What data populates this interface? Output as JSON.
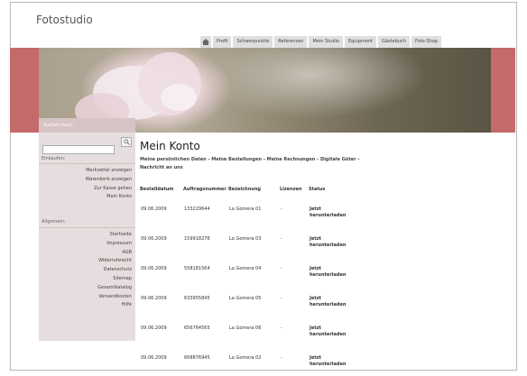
{
  "brand": "Fotostudio",
  "top_nav": [
    "Profil",
    "Schwerpunkte",
    "Referenzen",
    "Mein Studio",
    "Equipment",
    "Gästebuch",
    "Foto-Shop"
  ],
  "sidebar": {
    "search_label": "Suchen nach:",
    "search_value": "",
    "shop_label": "Einkaufen:",
    "shop_links": [
      "Merkzettel anzeigen",
      "Warenkorb anzeigen",
      "Zur Kasse gehen",
      "Mein Konto"
    ],
    "general_label": "Allgemein:",
    "general_links": [
      "Startseite",
      "Impressum",
      "AGB",
      "Widerrufsrecht",
      "Datenschutz",
      "Sitemap",
      "Gesamtkatalog",
      "Versandkosten",
      "Hilfe"
    ]
  },
  "main": {
    "title": "Mein Konto",
    "subnav": [
      "Meine persönlichen Daten",
      "Meine Bestellungen",
      "Meine Rechnungen",
      "Digitale Güter",
      "Nachricht an uns"
    ],
    "table": {
      "headers": [
        "Bestelldatum",
        "Auftragsnummer",
        "Bezeichnung",
        "Lizenzen",
        "Status"
      ],
      "rows": [
        [
          "09.06.2009",
          "133229644",
          "La Gomera 01",
          "-",
          "Jetzt herunterladen"
        ],
        [
          "09.06.2009",
          "159918276",
          "La Gomera 03",
          "-",
          "Jetzt herunterladen"
        ],
        [
          "09.06.2009",
          "558181564",
          "La Gomera 04",
          "-",
          "Jetzt herunterladen"
        ],
        [
          "09.06.2009",
          "633955845",
          "La Gomera 05",
          "-",
          "Jetzt herunterladen"
        ],
        [
          "09.06.2009",
          "656764565",
          "La Gomera 06",
          "-",
          "Jetzt herunterladen"
        ],
        [
          "09.06.2009",
          "668876945",
          "La Gomera 02",
          "-",
          "Jetzt herunterladen"
        ]
      ]
    }
  }
}
